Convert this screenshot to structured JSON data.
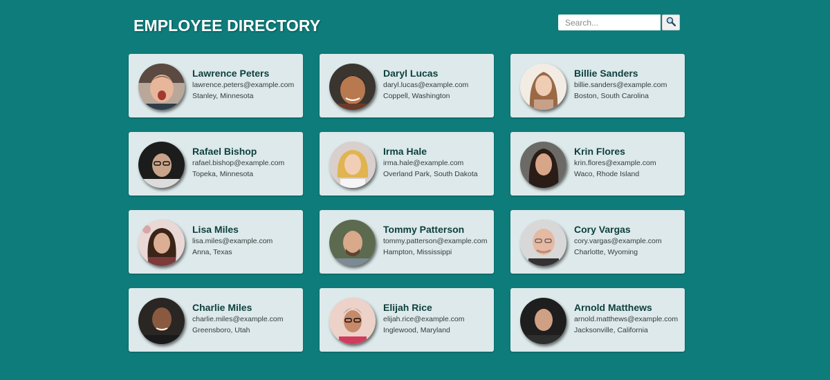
{
  "header": {
    "title": "EMPLOYEE DIRECTORY"
  },
  "search": {
    "placeholder": "Search...",
    "value": "",
    "button_icon": "search-icon"
  },
  "colors": {
    "background": "#0e7c7b",
    "card": "#dde9ea",
    "name_text": "#0d3f3e"
  },
  "employees": [
    {
      "name": "Lawrence Peters",
      "email": "lawrence.peters@example.com",
      "location": "Stanley, Minnesota",
      "photo": "avatar-photo"
    },
    {
      "name": "Daryl Lucas",
      "email": "daryl.lucas@example.com",
      "location": "Coppell, Washington",
      "photo": "avatar-photo"
    },
    {
      "name": "Billie Sanders",
      "email": "billie.sanders@example.com",
      "location": "Boston, South Carolina",
      "photo": "avatar-photo"
    },
    {
      "name": "Rafael Bishop",
      "email": "rafael.bishop@example.com",
      "location": "Topeka, Minnesota",
      "photo": "avatar-photo"
    },
    {
      "name": "Irma Hale",
      "email": "irma.hale@example.com",
      "location": "Overland Park, South Dakota",
      "photo": "avatar-photo"
    },
    {
      "name": "Krin Flores",
      "email": "krin.flores@example.com",
      "location": "Waco, Rhode Island",
      "photo": "avatar-photo"
    },
    {
      "name": "Lisa Miles",
      "email": "lisa.miles@example.com",
      "location": "Anna, Texas",
      "photo": "avatar-photo"
    },
    {
      "name": "Tommy Patterson",
      "email": "tommy.patterson@example.com",
      "location": "Hampton, Mississippi",
      "photo": "avatar-photo"
    },
    {
      "name": "Cory Vargas",
      "email": "cory.vargas@example.com",
      "location": "Charlotte, Wyoming",
      "photo": "avatar-photo"
    },
    {
      "name": "Charlie Miles",
      "email": "charlie.miles@example.com",
      "location": "Greensboro, Utah",
      "photo": "avatar-photo"
    },
    {
      "name": "Elijah Rice",
      "email": "elijah.rice@example.com",
      "location": "Inglewood, Maryland",
      "photo": "avatar-photo"
    },
    {
      "name": "Arnold Matthews",
      "email": "arnold.matthews@example.com",
      "location": "Jacksonville, California",
      "photo": "avatar-photo"
    }
  ]
}
